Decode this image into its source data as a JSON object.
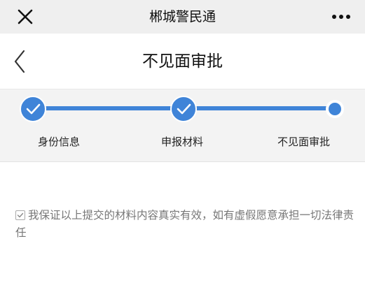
{
  "app": {
    "title": "郴城警民通"
  },
  "icons": {
    "close": "close-icon",
    "more": "more-icon",
    "back": "back-icon",
    "check": "check-icon"
  },
  "navbar": {
    "title": "不见面审批"
  },
  "steps": [
    {
      "label": "身份信息",
      "status": "completed"
    },
    {
      "label": "申报材料",
      "status": "completed"
    },
    {
      "label": "不见面审批",
      "status": "current"
    }
  ],
  "agreement": {
    "checked": true,
    "text": "我保证以上提交的材料内容真实有效，如有虚假愿意承担一切法律责任"
  },
  "colors": {
    "accent": "#3f84d8",
    "topbar_bg": "#efefef",
    "steps_bg": "#f3f3f3",
    "agreement_text": "#777777"
  }
}
